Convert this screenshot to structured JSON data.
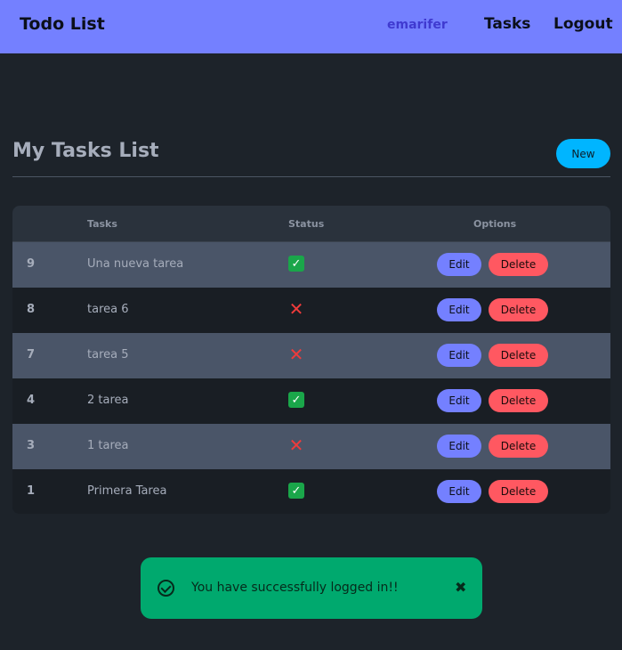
{
  "navbar": {
    "brand": "Todo List",
    "user": "emarifer",
    "tasks_link": "Tasks",
    "logout_link": "Logout",
    "color": "#7480ff"
  },
  "main": {
    "title": "My Tasks List",
    "new_button": "New"
  },
  "table": {
    "headers": [
      "",
      "Tasks",
      "Status",
      "Options"
    ],
    "rows": [
      {
        "id": "9",
        "task": "Una nueva tarea",
        "status": "✅",
        "edit": "Edit",
        "delete": "Delete"
      },
      {
        "id": "8",
        "task": "tarea 6",
        "status": "❌",
        "edit": "Edit",
        "delete": "Delete"
      },
      {
        "id": "7",
        "task": "tarea 5",
        "status": "❌",
        "edit": "Edit",
        "delete": "Delete"
      },
      {
        "id": "4",
        "task": "2 tarea",
        "status": "✅",
        "edit": "Edit",
        "delete": "Delete"
      },
      {
        "id": "3",
        "task": "1 tarea",
        "status": "❌",
        "edit": "Edit",
        "delete": "Delete"
      },
      {
        "id": "1",
        "task": "Primera Tarea",
        "status": "✅",
        "edit": "Edit",
        "delete": "Delete"
      }
    ]
  },
  "toast": {
    "message": "You have successfully logged in!!",
    "icon": "check-circle-icon",
    "close_label": "✖",
    "color": "#00a96e"
  }
}
